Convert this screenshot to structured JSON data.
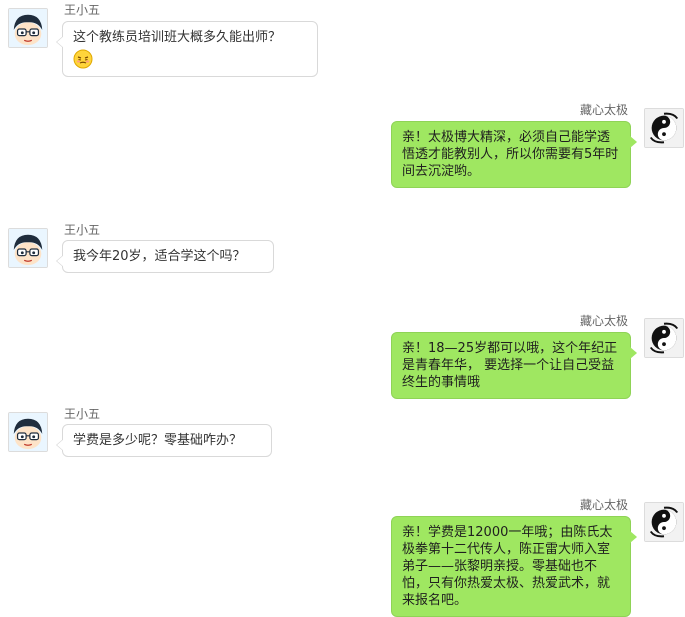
{
  "messages": [
    {
      "sender": "王小五",
      "side": "left",
      "text": "这个教练员培训班大概多久能出师？",
      "emoji": "embarrassed-emoji"
    },
    {
      "sender": "藏心太极",
      "side": "right",
      "text": "亲！太极博大精深，必须自己能学透悟透才能教别人，所以你需要有5年时间去沉淀哟。"
    },
    {
      "sender": "王小五",
      "side": "left",
      "text": "我今年20岁，适合学这个吗？"
    },
    {
      "sender": "藏心太极",
      "side": "right",
      "text": "亲！18—25岁都可以哦，这个年纪正是青春年华， 要选择一个让自己受益终生的事情哦"
    },
    {
      "sender": "王小五",
      "side": "left",
      "text": "学费是多少呢？零基础咋办？"
    },
    {
      "sender": "藏心太极",
      "side": "right",
      "text": "亲！学费是12000一年哦；由陈氏太极拳第十二代传人，陈正雷大师入室弟子——张黎明亲授。零基础也不怕，只有你热爱太极、热爱武术，就来报名吧。"
    }
  ],
  "colors": {
    "right_bubble": "#9fe761",
    "left_bubble": "#ffffff",
    "name_text": "#666666"
  }
}
